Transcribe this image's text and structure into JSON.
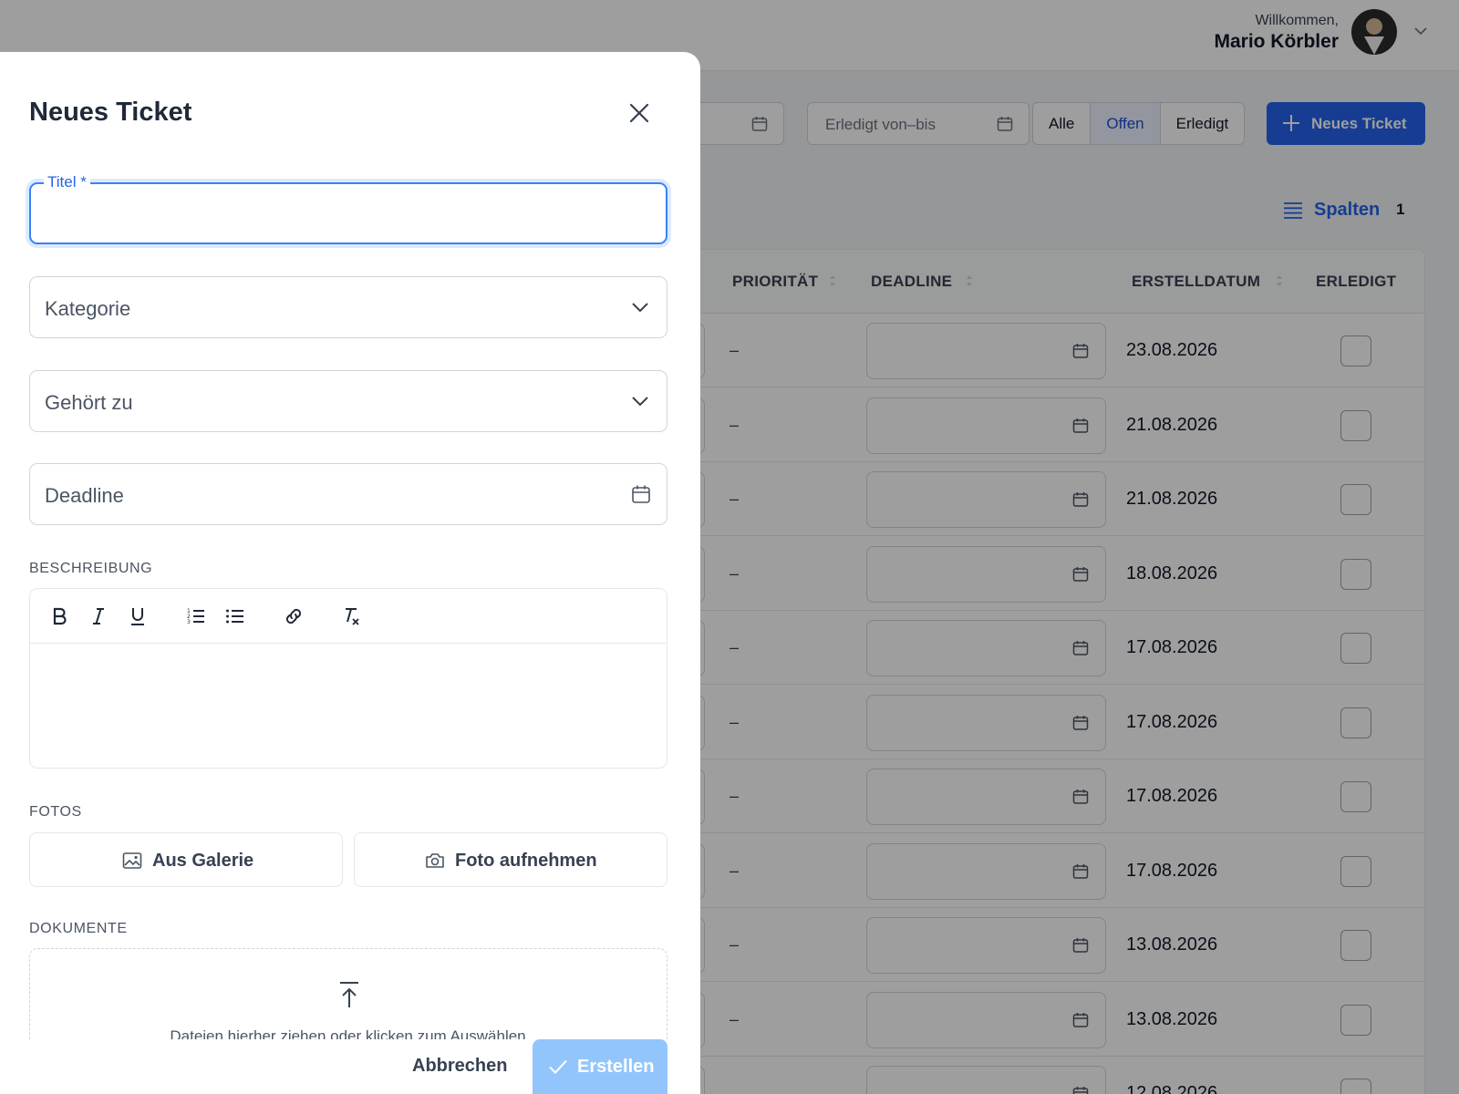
{
  "header": {
    "welcome": "Willkommen,",
    "user_name": "Mario Körbler"
  },
  "toolbar": {
    "created_range_placeholder": "",
    "done_range_placeholder": "Erledigt von–bis",
    "filters": [
      "Alle",
      "Offen",
      "Erledigt"
    ],
    "active_filter": "Offen",
    "new_ticket_label": "Neues Ticket"
  },
  "columns_button": {
    "label": "Spalten",
    "count": "1"
  },
  "table": {
    "headers": {
      "priority": "PRIORITÄT",
      "deadline": "DEADLINE",
      "created": "ERSTELLDATUM",
      "done": "ERLEDIGT"
    },
    "rows": [
      {
        "priority": "–",
        "created": "23.08.2026"
      },
      {
        "priority": "–",
        "created": "21.08.2026"
      },
      {
        "priority": "–",
        "created": "21.08.2026"
      },
      {
        "priority": "–",
        "created": "18.08.2026"
      },
      {
        "priority": "–",
        "created": "17.08.2026"
      },
      {
        "priority": "–",
        "created": "17.08.2026"
      },
      {
        "priority": "–",
        "created": "17.08.2026"
      },
      {
        "priority": "–",
        "created": "17.08.2026"
      },
      {
        "priority": "–",
        "created": "13.08.2026"
      },
      {
        "priority": "–",
        "created": "13.08.2026"
      },
      {
        "priority": "",
        "created": "12.08.2026"
      }
    ]
  },
  "drawer": {
    "title": "Neues Ticket",
    "title_field_label": "Titel *",
    "title_field_value": "",
    "category_placeholder": "Kategorie",
    "belongs_to_placeholder": "Gehört zu",
    "deadline_placeholder": "Deadline",
    "description_label": "BESCHREIBUNG",
    "photos_label": "FOTOS",
    "gallery_label": "Aus Galerie",
    "camera_label": "Foto aufnehmen",
    "documents_label": "DOKUMENTE",
    "dropzone_text": "Dateien hierher ziehen oder klicken zum Auswählen",
    "cancel_label": "Abbrechen",
    "create_label": "Erstellen"
  },
  "colors": {
    "primary": "#2563eb",
    "primary_disabled": "#93c5fd",
    "focus_ring": "#3b82f6",
    "overlay": "rgba(0,0,0,0.38)"
  }
}
